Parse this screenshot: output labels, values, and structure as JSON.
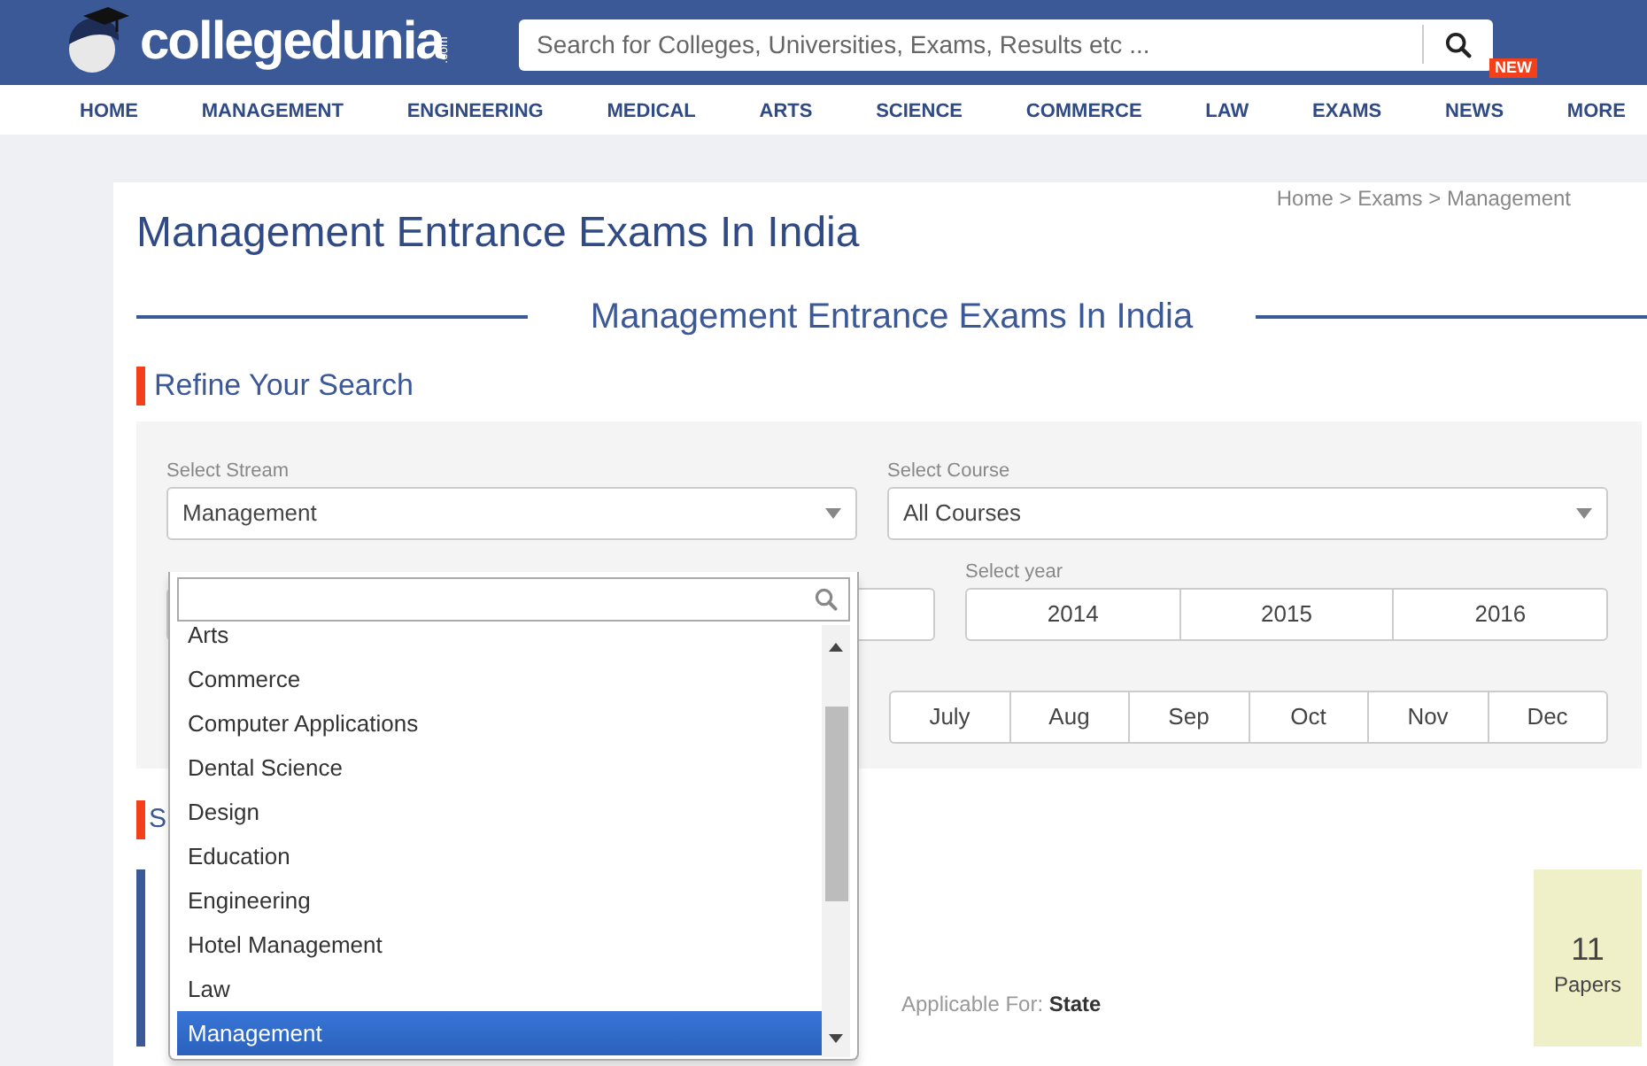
{
  "header": {
    "logo_text": "collegedunia",
    "logo_suffix": ".com",
    "search": {
      "placeholder": "Search for Colleges, Universities, Exams, Results etc ..."
    }
  },
  "nav": [
    {
      "label": "HOME"
    },
    {
      "label": "MANAGEMENT"
    },
    {
      "label": "ENGINEERING"
    },
    {
      "label": "MEDICAL"
    },
    {
      "label": "ARTS"
    },
    {
      "label": "SCIENCE"
    },
    {
      "label": "COMMERCE"
    },
    {
      "label": "LAW"
    },
    {
      "label": "EXAMS"
    },
    {
      "label": "NEWS",
      "badge": "NEW"
    },
    {
      "label": "MORE"
    }
  ],
  "breadcrumb": [
    "Home",
    "Exams",
    "Management"
  ],
  "breadcrumb_separator": ">",
  "page_title": "Management Entrance Exams In India",
  "section_heading": "Management Entrance Exams In India",
  "refine_heading": "Refine Your Search",
  "filters": {
    "stream": {
      "label": "Select Stream",
      "value": "Management"
    },
    "course": {
      "label": "Select Course",
      "value": "All Courses"
    },
    "year": {
      "label": "Select year",
      "options": [
        {
          "label": "2014",
          "selected": false
        },
        {
          "label": "2015",
          "selected": false
        },
        {
          "label": "2016",
          "selected": false
        }
      ]
    },
    "months": [
      {
        "label": "July",
        "selected": false
      },
      {
        "label": "Aug",
        "selected": false
      },
      {
        "label": "Sep",
        "selected": false
      },
      {
        "label": "Oct",
        "selected": false
      },
      {
        "label": "Nov",
        "selected": false
      },
      {
        "label": "Dec",
        "selected": false
      }
    ]
  },
  "stream_dropdown": {
    "options": [
      {
        "label": "Arts",
        "selected": false
      },
      {
        "label": "Commerce",
        "selected": false
      },
      {
        "label": "Computer Applications",
        "selected": false
      },
      {
        "label": "Dental Science",
        "selected": false
      },
      {
        "label": "Design",
        "selected": false
      },
      {
        "label": "Education",
        "selected": false
      },
      {
        "label": "Engineering",
        "selected": false
      },
      {
        "label": "Hotel Management",
        "selected": false
      },
      {
        "label": "Law",
        "selected": false
      },
      {
        "label": "Management",
        "selected": true
      }
    ]
  },
  "results_heading": "S",
  "result": {
    "applicable": "Applicable For: **State**",
    "papers_count": "11",
    "papers_label": "Papers"
  }
}
